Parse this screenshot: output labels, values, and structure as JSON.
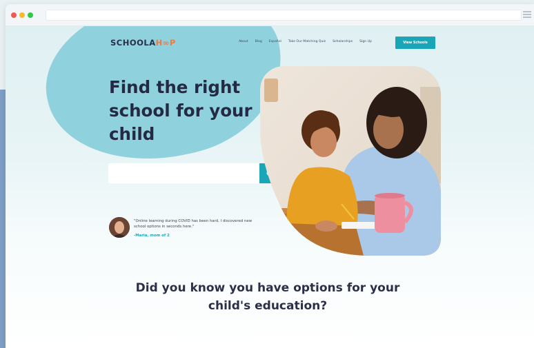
{
  "colors": {
    "accent": "#1aa6b7",
    "blob": "#8fd1dc",
    "heading": "#252a44",
    "logo_accent": "#f07b3f"
  },
  "icons": {
    "search": "search-icon",
    "menu": "menu-icon"
  },
  "header": {
    "logo_main": "SCHOOLA",
    "logo_accent": "H∞P",
    "nav": [
      "About",
      "Blog",
      "Español",
      "Take Our Matching Quiz",
      "Scholarships",
      "Sign Up"
    ],
    "cta_label": "View Schools"
  },
  "hero": {
    "title": "Find the right school for your child",
    "search_placeholder": "",
    "quote": "\"Online learning during COVID has been hard, I discovered new school options in seconds here.\"",
    "quote_author": "-Maria, mom of 2"
  },
  "options": {
    "line_prefix": "Did you know ",
    "line_bold": "you have options",
    "line_suffix": " for your child's education?"
  }
}
